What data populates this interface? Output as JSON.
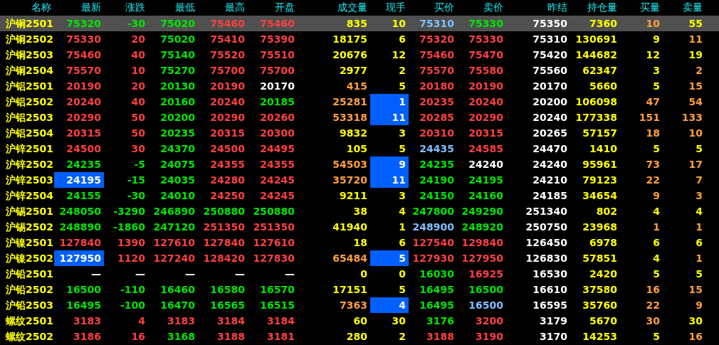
{
  "table": {
    "columns": [
      "名称",
      "最新",
      "涨跌",
      "最低",
      "最高",
      "开盘",
      "成交量",
      "现手",
      "买价",
      "卖价",
      "昨结",
      "持仓量",
      "买量",
      "卖量"
    ],
    "rows": [
      {
        "selected": true,
        "cells": [
          {
            "text": "沪铜2501",
            "color": "#ffff00",
            "flash": false
          },
          {
            "text": "75320",
            "color": "#00e600",
            "flash": false
          },
          {
            "text": "-30",
            "color": "#00e600",
            "flash": false
          },
          {
            "text": "75020",
            "color": "#00e600",
            "flash": false
          },
          {
            "text": "75460",
            "color": "#ff4040",
            "flash": false
          },
          {
            "text": "75460",
            "color": "#ff4040",
            "flash": false
          },
          {
            "text": "835",
            "color": "#ffff00",
            "flash": false
          },
          {
            "text": "10",
            "color": "#ffff00",
            "flash": false
          },
          {
            "text": "75310",
            "color": "#80c0ff",
            "flash": false
          },
          {
            "text": "75330",
            "color": "#00e600",
            "flash": false
          },
          {
            "text": "75350",
            "color": "#ffffff",
            "flash": false
          },
          {
            "text": "7360",
            "color": "#ffff00",
            "flash": false
          },
          {
            "text": "10",
            "color": "#ffa040",
            "flash": false
          },
          {
            "text": "55",
            "color": "#ffff00",
            "flash": false
          }
        ]
      },
      {
        "selected": false,
        "cells": [
          {
            "text": "沪铜2502",
            "color": "#ffff00",
            "flash": false
          },
          {
            "text": "75330",
            "color": "#ff4040",
            "flash": false
          },
          {
            "text": "20",
            "color": "#ff4040",
            "flash": false
          },
          {
            "text": "75020",
            "color": "#00e600",
            "flash": false
          },
          {
            "text": "75410",
            "color": "#ff4040",
            "flash": false
          },
          {
            "text": "75390",
            "color": "#ff4040",
            "flash": false
          },
          {
            "text": "18175",
            "color": "#ffff00",
            "flash": false
          },
          {
            "text": "6",
            "color": "#ffff00",
            "flash": false
          },
          {
            "text": "75320",
            "color": "#ff4040",
            "flash": false
          },
          {
            "text": "75330",
            "color": "#ff4040",
            "flash": false
          },
          {
            "text": "75310",
            "color": "#ffffff",
            "flash": false
          },
          {
            "text": "130691",
            "color": "#ffff00",
            "flash": false
          },
          {
            "text": "9",
            "color": "#ffff00",
            "flash": false
          },
          {
            "text": "11",
            "color": "#ffa040",
            "flash": false
          }
        ]
      },
      {
        "selected": false,
        "cells": [
          {
            "text": "沪铜2503",
            "color": "#ffff00",
            "flash": false
          },
          {
            "text": "75460",
            "color": "#ff4040",
            "flash": false
          },
          {
            "text": "40",
            "color": "#ff4040",
            "flash": false
          },
          {
            "text": "75140",
            "color": "#00e600",
            "flash": false
          },
          {
            "text": "75520",
            "color": "#ff4040",
            "flash": false
          },
          {
            "text": "75510",
            "color": "#ff4040",
            "flash": false
          },
          {
            "text": "20676",
            "color": "#ffff00",
            "flash": false
          },
          {
            "text": "12",
            "color": "#ffff00",
            "flash": false
          },
          {
            "text": "75460",
            "color": "#ff4040",
            "flash": false
          },
          {
            "text": "75470",
            "color": "#ff4040",
            "flash": false
          },
          {
            "text": "75420",
            "color": "#ffffff",
            "flash": false
          },
          {
            "text": "144682",
            "color": "#ffff00",
            "flash": false
          },
          {
            "text": "12",
            "color": "#ffff00",
            "flash": false
          },
          {
            "text": "19",
            "color": "#ffff00",
            "flash": false
          }
        ]
      },
      {
        "selected": false,
        "cells": [
          {
            "text": "沪铜2504",
            "color": "#ffff00",
            "flash": false
          },
          {
            "text": "75570",
            "color": "#ff4040",
            "flash": false
          },
          {
            "text": "10",
            "color": "#ff4040",
            "flash": false
          },
          {
            "text": "75270",
            "color": "#00e600",
            "flash": false
          },
          {
            "text": "75700",
            "color": "#ff4040",
            "flash": false
          },
          {
            "text": "75700",
            "color": "#ff4040",
            "flash": false
          },
          {
            "text": "2977",
            "color": "#ffff00",
            "flash": false
          },
          {
            "text": "2",
            "color": "#ffff00",
            "flash": false
          },
          {
            "text": "75570",
            "color": "#ff4040",
            "flash": false
          },
          {
            "text": "75580",
            "color": "#ff4040",
            "flash": false
          },
          {
            "text": "75560",
            "color": "#ffffff",
            "flash": false
          },
          {
            "text": "62347",
            "color": "#ffff00",
            "flash": false
          },
          {
            "text": "3",
            "color": "#ffff00",
            "flash": false
          },
          {
            "text": "2",
            "color": "#ffa040",
            "flash": false
          }
        ]
      },
      {
        "selected": false,
        "cells": [
          {
            "text": "沪铝2501",
            "color": "#ffff00",
            "flash": false
          },
          {
            "text": "20190",
            "color": "#ff4040",
            "flash": false
          },
          {
            "text": "20",
            "color": "#ff4040",
            "flash": false
          },
          {
            "text": "20130",
            "color": "#00e600",
            "flash": false
          },
          {
            "text": "20190",
            "color": "#ff4040",
            "flash": false
          },
          {
            "text": "20170",
            "color": "#ffffff",
            "flash": false
          },
          {
            "text": "415",
            "color": "#ffa040",
            "flash": false
          },
          {
            "text": "5",
            "color": "#ffff00",
            "flash": false
          },
          {
            "text": "20180",
            "color": "#ff4040",
            "flash": false
          },
          {
            "text": "20190",
            "color": "#ff4040",
            "flash": false
          },
          {
            "text": "20170",
            "color": "#ffffff",
            "flash": false
          },
          {
            "text": "5660",
            "color": "#ffff00",
            "flash": false
          },
          {
            "text": "5",
            "color": "#ffff00",
            "flash": false
          },
          {
            "text": "15",
            "color": "#ffa040",
            "flash": false
          }
        ]
      },
      {
        "selected": false,
        "cells": [
          {
            "text": "沪铝2502",
            "color": "#ffff00",
            "flash": false
          },
          {
            "text": "20240",
            "color": "#ff4040",
            "flash": false
          },
          {
            "text": "40",
            "color": "#ff4040",
            "flash": false
          },
          {
            "text": "20160",
            "color": "#00e600",
            "flash": false
          },
          {
            "text": "20240",
            "color": "#ff4040",
            "flash": false
          },
          {
            "text": "20185",
            "color": "#00e600",
            "flash": false
          },
          {
            "text": "25281",
            "color": "#ffa040",
            "flash": false
          },
          {
            "text": "1",
            "color": "#ffffff",
            "flash": true
          },
          {
            "text": "20235",
            "color": "#ff4040",
            "flash": false
          },
          {
            "text": "20240",
            "color": "#ff4040",
            "flash": false
          },
          {
            "text": "20200",
            "color": "#ffffff",
            "flash": false
          },
          {
            "text": "106098",
            "color": "#ffff00",
            "flash": false
          },
          {
            "text": "47",
            "color": "#ffa040",
            "flash": false
          },
          {
            "text": "54",
            "color": "#ffa040",
            "flash": false
          }
        ]
      },
      {
        "selected": false,
        "cells": [
          {
            "text": "沪铝2503",
            "color": "#ffff00",
            "flash": false
          },
          {
            "text": "20290",
            "color": "#ff4040",
            "flash": false
          },
          {
            "text": "50",
            "color": "#ff4040",
            "flash": false
          },
          {
            "text": "20200",
            "color": "#00e600",
            "flash": false
          },
          {
            "text": "20290",
            "color": "#ff4040",
            "flash": false
          },
          {
            "text": "20260",
            "color": "#ff4040",
            "flash": false
          },
          {
            "text": "53318",
            "color": "#ffa040",
            "flash": false
          },
          {
            "text": "11",
            "color": "#ffffff",
            "flash": true
          },
          {
            "text": "20285",
            "color": "#ff4040",
            "flash": false
          },
          {
            "text": "20290",
            "color": "#ff4040",
            "flash": false
          },
          {
            "text": "20240",
            "color": "#ffffff",
            "flash": false
          },
          {
            "text": "177338",
            "color": "#ffff00",
            "flash": false
          },
          {
            "text": "151",
            "color": "#ffa040",
            "flash": false
          },
          {
            "text": "133",
            "color": "#ffa040",
            "flash": false
          }
        ]
      },
      {
        "selected": false,
        "cells": [
          {
            "text": "沪铝2504",
            "color": "#ffff00",
            "flash": false
          },
          {
            "text": "20315",
            "color": "#ff4040",
            "flash": false
          },
          {
            "text": "50",
            "color": "#ff4040",
            "flash": false
          },
          {
            "text": "20235",
            "color": "#00e600",
            "flash": false
          },
          {
            "text": "20315",
            "color": "#ff4040",
            "flash": false
          },
          {
            "text": "20300",
            "color": "#ff4040",
            "flash": false
          },
          {
            "text": "9832",
            "color": "#ffff00",
            "flash": false
          },
          {
            "text": "3",
            "color": "#ffff00",
            "flash": false
          },
          {
            "text": "20310",
            "color": "#ff4040",
            "flash": false
          },
          {
            "text": "20315",
            "color": "#ff4040",
            "flash": false
          },
          {
            "text": "20265",
            "color": "#ffffff",
            "flash": false
          },
          {
            "text": "57157",
            "color": "#ffff00",
            "flash": false
          },
          {
            "text": "18",
            "color": "#ffa040",
            "flash": false
          },
          {
            "text": "10",
            "color": "#ffa040",
            "flash": false
          }
        ]
      },
      {
        "selected": false,
        "cells": [
          {
            "text": "沪锌2501",
            "color": "#ffff00",
            "flash": false
          },
          {
            "text": "24500",
            "color": "#ff4040",
            "flash": false
          },
          {
            "text": "30",
            "color": "#ff4040",
            "flash": false
          },
          {
            "text": "24370",
            "color": "#00e600",
            "flash": false
          },
          {
            "text": "24500",
            "color": "#ff4040",
            "flash": false
          },
          {
            "text": "24495",
            "color": "#ff4040",
            "flash": false
          },
          {
            "text": "105",
            "color": "#ffff00",
            "flash": false
          },
          {
            "text": "5",
            "color": "#ffff00",
            "flash": false
          },
          {
            "text": "24435",
            "color": "#80c0ff",
            "flash": false
          },
          {
            "text": "24585",
            "color": "#ff4040",
            "flash": false
          },
          {
            "text": "24470",
            "color": "#ffffff",
            "flash": false
          },
          {
            "text": "1410",
            "color": "#ffff00",
            "flash": false
          },
          {
            "text": "5",
            "color": "#ffff00",
            "flash": false
          },
          {
            "text": "5",
            "color": "#ffff00",
            "flash": false
          }
        ]
      },
      {
        "selected": false,
        "cells": [
          {
            "text": "沪锌2502",
            "color": "#ffff00",
            "flash": false
          },
          {
            "text": "24235",
            "color": "#00e600",
            "flash": false
          },
          {
            "text": "-5",
            "color": "#00e600",
            "flash": false
          },
          {
            "text": "24075",
            "color": "#00e600",
            "flash": false
          },
          {
            "text": "24355",
            "color": "#ff4040",
            "flash": false
          },
          {
            "text": "24355",
            "color": "#ff4040",
            "flash": false
          },
          {
            "text": "54503",
            "color": "#ffa040",
            "flash": false
          },
          {
            "text": "9",
            "color": "#ffffff",
            "flash": true
          },
          {
            "text": "24235",
            "color": "#00e600",
            "flash": false
          },
          {
            "text": "24240",
            "color": "#ffffff",
            "flash": false
          },
          {
            "text": "24240",
            "color": "#ffffff",
            "flash": false
          },
          {
            "text": "95961",
            "color": "#ffff00",
            "flash": false
          },
          {
            "text": "73",
            "color": "#ffa040",
            "flash": false
          },
          {
            "text": "17",
            "color": "#ffa040",
            "flash": false
          }
        ]
      },
      {
        "selected": false,
        "cells": [
          {
            "text": "沪锌2503",
            "color": "#ffff00",
            "flash": false
          },
          {
            "text": "24195",
            "color": "#ffffff",
            "flash": true
          },
          {
            "text": "-15",
            "color": "#00e600",
            "flash": false
          },
          {
            "text": "24035",
            "color": "#00e600",
            "flash": false
          },
          {
            "text": "24280",
            "color": "#ff4040",
            "flash": false
          },
          {
            "text": "24245",
            "color": "#ff4040",
            "flash": false
          },
          {
            "text": "35720",
            "color": "#ffa040",
            "flash": false
          },
          {
            "text": "11",
            "color": "#ffffff",
            "flash": true
          },
          {
            "text": "24190",
            "color": "#00e600",
            "flash": false
          },
          {
            "text": "24195",
            "color": "#00e600",
            "flash": false
          },
          {
            "text": "24210",
            "color": "#ffffff",
            "flash": false
          },
          {
            "text": "79123",
            "color": "#ffff00",
            "flash": false
          },
          {
            "text": "22",
            "color": "#ffa040",
            "flash": false
          },
          {
            "text": "7",
            "color": "#ffa040",
            "flash": false
          }
        ]
      },
      {
        "selected": false,
        "cells": [
          {
            "text": "沪锌2504",
            "color": "#ffff00",
            "flash": false
          },
          {
            "text": "24155",
            "color": "#00e600",
            "flash": false
          },
          {
            "text": "-30",
            "color": "#00e600",
            "flash": false
          },
          {
            "text": "24010",
            "color": "#00e600",
            "flash": false
          },
          {
            "text": "24250",
            "color": "#ff4040",
            "flash": false
          },
          {
            "text": "24245",
            "color": "#ff4040",
            "flash": false
          },
          {
            "text": "9211",
            "color": "#ffff00",
            "flash": false
          },
          {
            "text": "3",
            "color": "#ffff00",
            "flash": false
          },
          {
            "text": "24150",
            "color": "#00e600",
            "flash": false
          },
          {
            "text": "24160",
            "color": "#00e600",
            "flash": false
          },
          {
            "text": "24185",
            "color": "#ffffff",
            "flash": false
          },
          {
            "text": "34654",
            "color": "#ffff00",
            "flash": false
          },
          {
            "text": "9",
            "color": "#ffa040",
            "flash": false
          },
          {
            "text": "3",
            "color": "#ffa040",
            "flash": false
          }
        ]
      },
      {
        "selected": false,
        "cells": [
          {
            "text": "沪锡2501",
            "color": "#ffff00",
            "flash": false
          },
          {
            "text": "248050",
            "color": "#00e600",
            "flash": false
          },
          {
            "text": "-3290",
            "color": "#00e600",
            "flash": false
          },
          {
            "text": "246890",
            "color": "#00e600",
            "flash": false
          },
          {
            "text": "250880",
            "color": "#00e600",
            "flash": false
          },
          {
            "text": "250880",
            "color": "#00e600",
            "flash": false
          },
          {
            "text": "38",
            "color": "#ffff00",
            "flash": false
          },
          {
            "text": "4",
            "color": "#ffff00",
            "flash": false
          },
          {
            "text": "247800",
            "color": "#00e600",
            "flash": false
          },
          {
            "text": "249290",
            "color": "#00e600",
            "flash": false
          },
          {
            "text": "251340",
            "color": "#ffffff",
            "flash": false
          },
          {
            "text": "802",
            "color": "#ffff00",
            "flash": false
          },
          {
            "text": "4",
            "color": "#ffff00",
            "flash": false
          },
          {
            "text": "4",
            "color": "#ffff00",
            "flash": false
          }
        ]
      },
      {
        "selected": false,
        "cells": [
          {
            "text": "沪锡2502",
            "color": "#ffff00",
            "flash": false
          },
          {
            "text": "248890",
            "color": "#00e600",
            "flash": false
          },
          {
            "text": "-1860",
            "color": "#00e600",
            "flash": false
          },
          {
            "text": "247120",
            "color": "#00e600",
            "flash": false
          },
          {
            "text": "251350",
            "color": "#ff4040",
            "flash": false
          },
          {
            "text": "251350",
            "color": "#ff4040",
            "flash": false
          },
          {
            "text": "41940",
            "color": "#ffff00",
            "flash": false
          },
          {
            "text": "1",
            "color": "#ffff00",
            "flash": false
          },
          {
            "text": "248900",
            "color": "#80c0ff",
            "flash": false
          },
          {
            "text": "248920",
            "color": "#00e600",
            "flash": false
          },
          {
            "text": "250750",
            "color": "#ffffff",
            "flash": false
          },
          {
            "text": "23968",
            "color": "#ffff00",
            "flash": false
          },
          {
            "text": "1",
            "color": "#ffa040",
            "flash": false
          },
          {
            "text": "1",
            "color": "#ffa040",
            "flash": false
          }
        ]
      },
      {
        "selected": false,
        "cells": [
          {
            "text": "沪镍2501",
            "color": "#ffff00",
            "flash": false
          },
          {
            "text": "127840",
            "color": "#ff4040",
            "flash": false
          },
          {
            "text": "1390",
            "color": "#ff4040",
            "flash": false
          },
          {
            "text": "127610",
            "color": "#ff4040",
            "flash": false
          },
          {
            "text": "127840",
            "color": "#ff4040",
            "flash": false
          },
          {
            "text": "127610",
            "color": "#ff4040",
            "flash": false
          },
          {
            "text": "18",
            "color": "#ffff00",
            "flash": false
          },
          {
            "text": "6",
            "color": "#ffff00",
            "flash": false
          },
          {
            "text": "127540",
            "color": "#ff4040",
            "flash": false
          },
          {
            "text": "129840",
            "color": "#ff4040",
            "flash": false
          },
          {
            "text": "126450",
            "color": "#ffffff",
            "flash": false
          },
          {
            "text": "6978",
            "color": "#ffff00",
            "flash": false
          },
          {
            "text": "6",
            "color": "#ffff00",
            "flash": false
          },
          {
            "text": "6",
            "color": "#ffff00",
            "flash": false
          }
        ]
      },
      {
        "selected": false,
        "cells": [
          {
            "text": "沪镍2502",
            "color": "#ffff00",
            "flash": false
          },
          {
            "text": "127950",
            "color": "#ffffff",
            "flash": true
          },
          {
            "text": "1120",
            "color": "#ff4040",
            "flash": false
          },
          {
            "text": "127240",
            "color": "#ff4040",
            "flash": false
          },
          {
            "text": "128420",
            "color": "#ff4040",
            "flash": false
          },
          {
            "text": "127830",
            "color": "#ff4040",
            "flash": false
          },
          {
            "text": "65484",
            "color": "#ffa040",
            "flash": false
          },
          {
            "text": "5",
            "color": "#ffffff",
            "flash": true
          },
          {
            "text": "127930",
            "color": "#ff4040",
            "flash": false
          },
          {
            "text": "127950",
            "color": "#ff4040",
            "flash": false
          },
          {
            "text": "126830",
            "color": "#ffffff",
            "flash": false
          },
          {
            "text": "57851",
            "color": "#ffff00",
            "flash": false
          },
          {
            "text": "4",
            "color": "#ffff00",
            "flash": false
          },
          {
            "text": "1",
            "color": "#ffa040",
            "flash": false
          }
        ]
      },
      {
        "selected": false,
        "cells": [
          {
            "text": "沪铅2501",
            "color": "#ffff00",
            "flash": false
          },
          {
            "text": "—",
            "color": "#ffffff",
            "flash": false
          },
          {
            "text": "—",
            "color": "#ffffff",
            "flash": false
          },
          {
            "text": "—",
            "color": "#ffffff",
            "flash": false
          },
          {
            "text": "—",
            "color": "#ffffff",
            "flash": false
          },
          {
            "text": "—",
            "color": "#ffffff",
            "flash": false
          },
          {
            "text": "0",
            "color": "#ffff00",
            "flash": false
          },
          {
            "text": "0",
            "color": "#ffff00",
            "flash": false
          },
          {
            "text": "16030",
            "color": "#00e600",
            "flash": false
          },
          {
            "text": "16925",
            "color": "#ff4040",
            "flash": false
          },
          {
            "text": "16530",
            "color": "#ffffff",
            "flash": false
          },
          {
            "text": "2420",
            "color": "#ffff00",
            "flash": false
          },
          {
            "text": "5",
            "color": "#ffff00",
            "flash": false
          },
          {
            "text": "5",
            "color": "#ffff00",
            "flash": false
          }
        ]
      },
      {
        "selected": false,
        "cells": [
          {
            "text": "沪铅2502",
            "color": "#ffff00",
            "flash": false
          },
          {
            "text": "16500",
            "color": "#00e600",
            "flash": false
          },
          {
            "text": "-110",
            "color": "#00e600",
            "flash": false
          },
          {
            "text": "16460",
            "color": "#00e600",
            "flash": false
          },
          {
            "text": "16580",
            "color": "#00e600",
            "flash": false
          },
          {
            "text": "16570",
            "color": "#00e600",
            "flash": false
          },
          {
            "text": "17151",
            "color": "#ffff00",
            "flash": false
          },
          {
            "text": "5",
            "color": "#ffff00",
            "flash": false
          },
          {
            "text": "16495",
            "color": "#00e600",
            "flash": false
          },
          {
            "text": "16500",
            "color": "#00e600",
            "flash": false
          },
          {
            "text": "16610",
            "color": "#ffffff",
            "flash": false
          },
          {
            "text": "37580",
            "color": "#ffff00",
            "flash": false
          },
          {
            "text": "16",
            "color": "#ffa040",
            "flash": false
          },
          {
            "text": "15",
            "color": "#ffa040",
            "flash": false
          }
        ]
      },
      {
        "selected": false,
        "cells": [
          {
            "text": "沪铅2503",
            "color": "#ffff00",
            "flash": false
          },
          {
            "text": "16495",
            "color": "#00e600",
            "flash": false
          },
          {
            "text": "-100",
            "color": "#00e600",
            "flash": false
          },
          {
            "text": "16470",
            "color": "#00e600",
            "flash": false
          },
          {
            "text": "16565",
            "color": "#00e600",
            "flash": false
          },
          {
            "text": "16515",
            "color": "#00e600",
            "flash": false
          },
          {
            "text": "7363",
            "color": "#ffa040",
            "flash": false
          },
          {
            "text": "4",
            "color": "#ffffff",
            "flash": true
          },
          {
            "text": "16495",
            "color": "#00e600",
            "flash": false
          },
          {
            "text": "16500",
            "color": "#80c0ff",
            "flash": false
          },
          {
            "text": "16595",
            "color": "#ffffff",
            "flash": false
          },
          {
            "text": "35760",
            "color": "#ffff00",
            "flash": false
          },
          {
            "text": "22",
            "color": "#ffa040",
            "flash": false
          },
          {
            "text": "9",
            "color": "#ffa040",
            "flash": false
          }
        ]
      },
      {
        "selected": false,
        "cells": [
          {
            "text": "螺纹2501",
            "color": "#ffff00",
            "flash": false
          },
          {
            "text": "3183",
            "color": "#ff4040",
            "flash": false
          },
          {
            "text": "4",
            "color": "#ff4040",
            "flash": false
          },
          {
            "text": "3183",
            "color": "#ff4040",
            "flash": false
          },
          {
            "text": "3184",
            "color": "#ff4040",
            "flash": false
          },
          {
            "text": "3184",
            "color": "#ff4040",
            "flash": false
          },
          {
            "text": "60",
            "color": "#ffff00",
            "flash": false
          },
          {
            "text": "30",
            "color": "#ffff00",
            "flash": false
          },
          {
            "text": "3176",
            "color": "#00e600",
            "flash": false
          },
          {
            "text": "3200",
            "color": "#ff4040",
            "flash": false
          },
          {
            "text": "3179",
            "color": "#ffffff",
            "flash": false
          },
          {
            "text": "5670",
            "color": "#ffff00",
            "flash": false
          },
          {
            "text": "30",
            "color": "#ffa040",
            "flash": false
          },
          {
            "text": "30",
            "color": "#ffff00",
            "flash": false
          }
        ]
      },
      {
        "selected": false,
        "cells": [
          {
            "text": "螺纹2502",
            "color": "#ffff00",
            "flash": false
          },
          {
            "text": "3186",
            "color": "#ff4040",
            "flash": false
          },
          {
            "text": "16",
            "color": "#ff4040",
            "flash": false
          },
          {
            "text": "3168",
            "color": "#00e600",
            "flash": false
          },
          {
            "text": "3188",
            "color": "#ff4040",
            "flash": false
          },
          {
            "text": "3181",
            "color": "#ff4040",
            "flash": false
          },
          {
            "text": "280",
            "color": "#ffff00",
            "flash": false
          },
          {
            "text": "2",
            "color": "#ffff00",
            "flash": false
          },
          {
            "text": "3188",
            "color": "#ff4040",
            "flash": false
          },
          {
            "text": "3190",
            "color": "#ff4040",
            "flash": false
          },
          {
            "text": "3170",
            "color": "#ffffff",
            "flash": false
          },
          {
            "text": "14253",
            "color": "#ffff00",
            "flash": false
          },
          {
            "text": "5",
            "color": "#ffff00",
            "flash": false
          },
          {
            "text": "16",
            "color": "#ffa040",
            "flash": false
          }
        ]
      }
    ]
  }
}
